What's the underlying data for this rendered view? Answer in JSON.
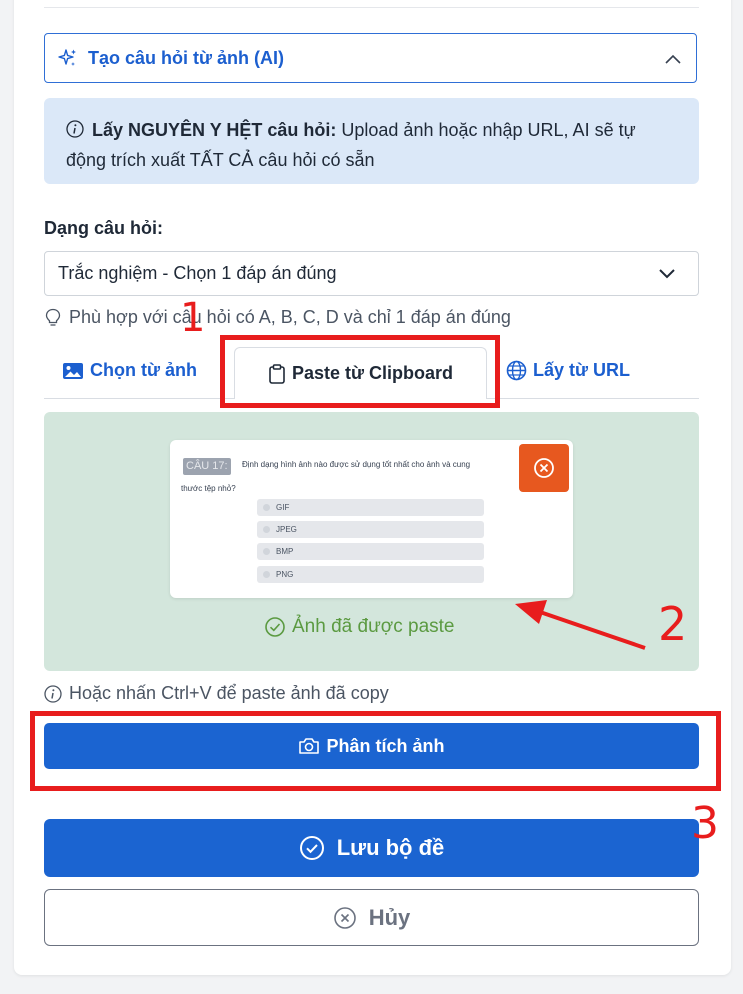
{
  "ai_section": {
    "title": "Tạo câu hỏi từ ảnh (AI)",
    "info_bold": "Lấy NGUYÊN Y HỆT câu hỏi:",
    "info_text": " Upload ảnh hoặc nhập URL, AI sẽ tự động trích xuất TẤT CẢ câu hỏi có sẵn"
  },
  "question_type": {
    "label": "Dạng câu hỏi:",
    "selected": "Trắc nghiệm - Chọn 1 đáp án đúng",
    "hint": "Phù hợp với câu hỏi có A, B, C, D và chỉ 1 đáp án đúng"
  },
  "tabs": [
    {
      "label": "Chọn từ ảnh",
      "active": false
    },
    {
      "label": "Paste từ Clipboard",
      "active": true
    },
    {
      "label": "Lấy từ URL",
      "active": false
    }
  ],
  "preview": {
    "badge": "CÂU 17:",
    "question_line1": "Định dạng hình ảnh nào được sử dụng tốt nhất cho ảnh và cung",
    "question_line2": "thước tệp nhỏ?",
    "options": [
      "GIF",
      "JPEG",
      "BMP",
      "PNG"
    ],
    "status": "Ảnh đã được paste"
  },
  "ctrl_hint": "Hoặc nhấn Ctrl+V để paste ảnh đã copy",
  "buttons": {
    "analyze": "Phân tích ảnh",
    "save": "Lưu bộ đề",
    "cancel": "Hủy"
  },
  "annotations": {
    "step1": "1",
    "step2": "2",
    "step3": "3",
    "color": "#e81d1d"
  },
  "colors": {
    "primary": "#1b64d1",
    "info_bg": "#dbe8f8",
    "dropzone_bg": "#d3e6dc",
    "success": "#5b9a41",
    "remove": "#e7581f"
  }
}
